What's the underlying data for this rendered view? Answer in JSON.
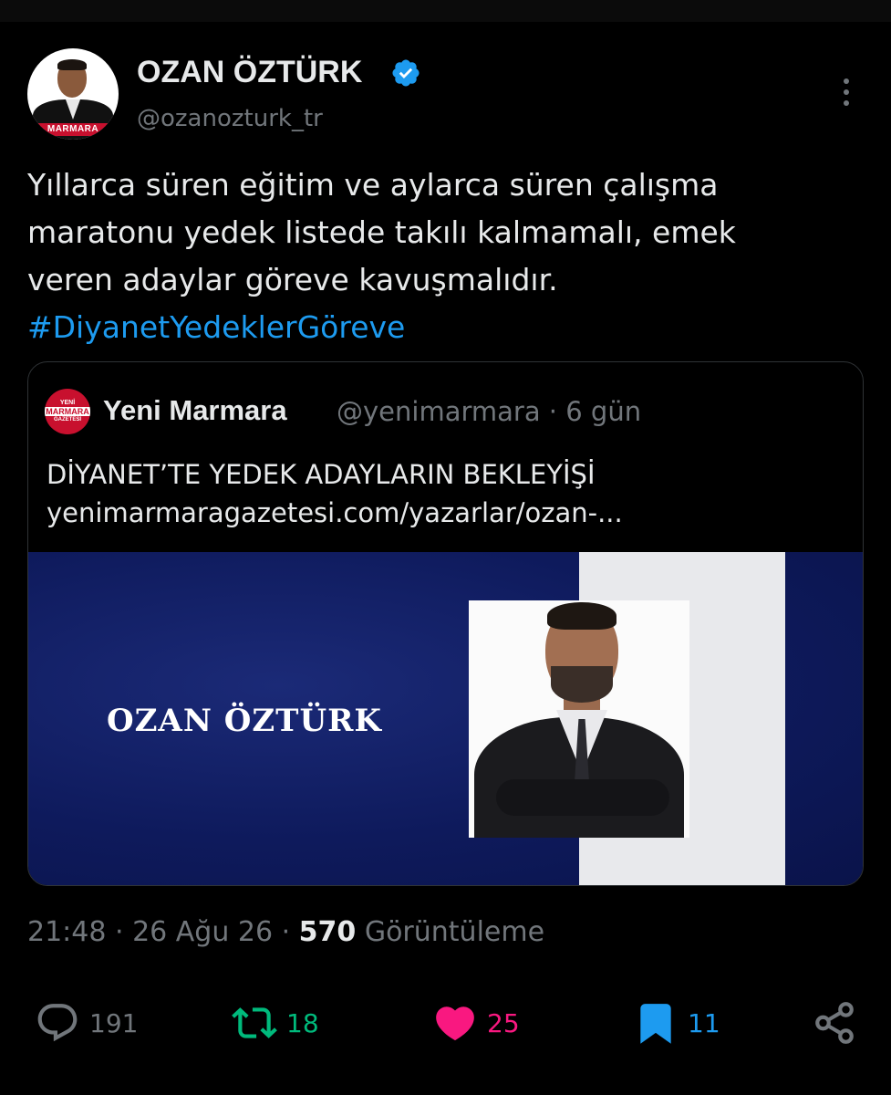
{
  "author": {
    "name": "OZAN ÖZTÜRK",
    "handle": "@ozanozturk_tr",
    "avatar_label": "MARMARA"
  },
  "tweet": {
    "lines": [
      "Yıllarca süren eğitim ve aylarca süren çalışma",
      "maratonu yedek listede takılı kalmamalı, emek",
      "veren adaylar göreve kavuşmalıdır."
    ],
    "hashtag": "#DiyanetYedeklerGöreve"
  },
  "quote": {
    "logo": {
      "line1": "YENİ",
      "line2": "MARMARA",
      "line3": "GAZETESİ"
    },
    "name": "Yeni Marmara",
    "handle_time": "@yenimarmara · 6 gün",
    "title": "DİYANET’TE YEDEK ADAYLARIN BEKLEYİŞİ",
    "link": "yenimarmaragazetesi.com/yazarlar/ozan-...",
    "image_text": "OZAN ÖZTÜRK"
  },
  "meta": {
    "time": "21:48 · 26 Ağu 26 · ",
    "views_count": "570",
    "views_label": " Görüntüleme"
  },
  "actions": {
    "reply": "191",
    "retweet": "18",
    "like": "25",
    "bookmark": "11"
  },
  "colors": {
    "background": "#000000",
    "accent": "#1d9bf0",
    "retweet": "#00ba7c",
    "like": "#f91880",
    "muted": "#71767b"
  },
  "icons": [
    "verified-badge-icon",
    "more-icon",
    "reply-icon",
    "retweet-icon",
    "like-icon",
    "bookmark-icon",
    "share-icon"
  ]
}
